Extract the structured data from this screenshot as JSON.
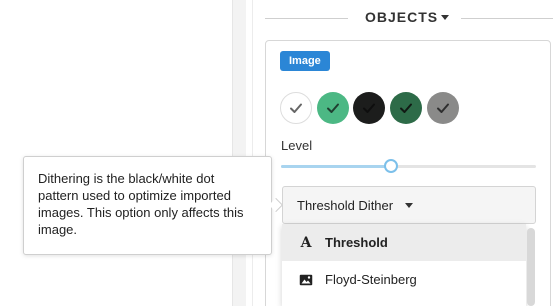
{
  "section": {
    "title": "OBJECTS"
  },
  "object": {
    "type_badge": "Image",
    "colors": [
      {
        "name": "white",
        "hex": "#ffffff",
        "check": "#666666"
      },
      {
        "name": "green",
        "hex": "#4cb884",
        "check": "#1f3f30"
      },
      {
        "name": "black",
        "hex": "#1c1d1c",
        "check": "#0e0e0e"
      },
      {
        "name": "dark-green",
        "hex": "#2d6b48",
        "check": "#111a14"
      },
      {
        "name": "gray",
        "hex": "#8a8a89",
        "check": "#2e2e2e"
      }
    ],
    "level": {
      "label": "Level",
      "value": 0.43
    },
    "dither_select": {
      "value": "Threshold Dither",
      "options": [
        {
          "label": "Threshold",
          "icon": "text-a-icon",
          "selected": true
        },
        {
          "label": "Floyd-Steinberg",
          "icon": "image-icon",
          "selected": false
        }
      ]
    }
  },
  "tooltip": {
    "text": "Dithering is the black/white dot pattern used to optimize imported images. This option only affects this image."
  },
  "colors": {
    "accent": "#2b86d6",
    "slider": "#a8d4ef"
  }
}
